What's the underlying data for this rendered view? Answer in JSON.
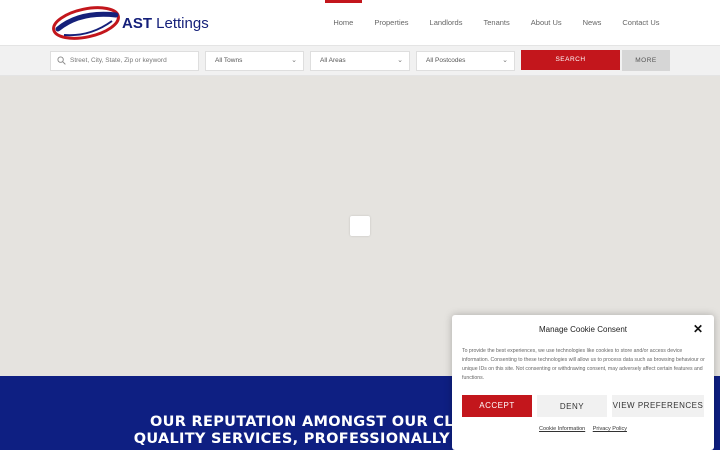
{
  "brand": {
    "name_bold": "AST",
    "name_rest": " Lettings",
    "primary_color": "#15207a",
    "accent_color": "#c3161c"
  },
  "nav": [
    {
      "label": "Home",
      "active": true
    },
    {
      "label": "Properties"
    },
    {
      "label": "Landlords"
    },
    {
      "label": "Tenants"
    },
    {
      "label": "About Us"
    },
    {
      "label": "News"
    },
    {
      "label": "Contact Us"
    }
  ],
  "search": {
    "keyword_placeholder": "Street, City, State, Zip or keyword",
    "towns": "All Towns",
    "areas": "All Areas",
    "postcodes": "All Postcodes",
    "search_label": "SEARCH",
    "more_label": "MORE"
  },
  "banner": {
    "line1": "OUR REPUTATION AMONGST OUR CLIENTS HAS BE",
    "line2": "QUALITY SERVICES, PROFESSIONALLY DELIVERED WIT",
    "background": "#0e1f82"
  },
  "cookie": {
    "title": "Manage Cookie Consent",
    "body": "To provide the best experiences, we use technologies like cookies to store and/or access device information. Consenting to these technologies will allow us to process data such as browsing behaviour or unique IDs on this site. Not consenting or withdrawing consent, may adversely affect certain features and functions.",
    "accept_label": "ACCEPT",
    "deny_label": "DENY",
    "prefs_label": "VIEW PREFERENCES",
    "cookie_info_link": "Cookie Information",
    "privacy_link": "Privacy Policy"
  }
}
